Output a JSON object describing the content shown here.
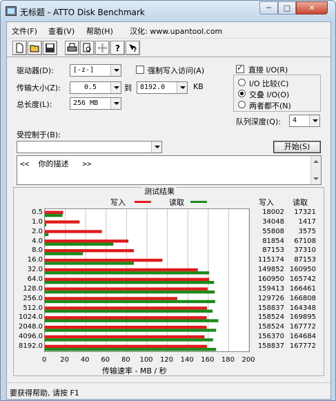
{
  "window": {
    "title": "无标题 - ATTO Disk Benchmark",
    "min_glyph": "─",
    "max_glyph": "□",
    "close_glyph": "✕"
  },
  "menu": [
    "文件(F)",
    "查看(V)",
    "帮助(H)",
    "汉化: www.upantool.com"
  ],
  "toolbar_icons": [
    "new-icon",
    "open-icon",
    "save-icon",
    "print-icon",
    "print-preview-icon",
    "move-icon",
    "help-icon",
    "context-help-icon"
  ],
  "settings": {
    "drive_label": "驱动器(D):",
    "drive_value": "[-z-]",
    "force_write_label": "强制写入访问(A)",
    "force_write_checked": false,
    "transfer_label": "传输大小(Z):",
    "transfer_from": "0.5",
    "transfer_to_label": "到",
    "transfer_to": "8192.0",
    "transfer_unit": "KB",
    "total_label": "总长度(L):",
    "total_value": "256 MB",
    "direct_io_label": "直接 I/O(R)",
    "direct_io_checked": true,
    "io_compare_label": "I/O 比较(C)",
    "io_interleave_label": "交叠 I/O(O)",
    "neither_label": "两者都不(N)",
    "queue_label": "队列深度(Q):",
    "queue_value": "4",
    "controlled_by_label": "受控制于(B):",
    "controlled_by_value": "",
    "start_label": "开始(S)",
    "description": "<<  你的描述   >>"
  },
  "results": {
    "title": "测试结果",
    "legend_write": "写入",
    "legend_read": "读取",
    "col_write": "写入",
    "col_read": "读取",
    "x_axis_label": "传输速率 - MB / 秒",
    "colors": {
      "write": "#e01b1b",
      "read": "#1b8a1b"
    }
  },
  "chart_data": {
    "type": "bar",
    "orientation": "horizontal",
    "title": "测试结果",
    "xlabel": "传输速率 - MB / 秒",
    "xlim": [
      0,
      200
    ],
    "xticks": [
      0,
      20,
      40,
      60,
      80,
      100,
      120,
      140,
      160,
      180,
      200
    ],
    "categories": [
      "0.5",
      "1.0",
      "2.0",
      "4.0",
      "8.0",
      "16.0",
      "32.0",
      "64.0",
      "128.0",
      "256.0",
      "512.0",
      "1024.0",
      "2048.0",
      "4096.0",
      "8192.0"
    ],
    "series": [
      {
        "name": "写入",
        "values": [
          18002,
          34048,
          55808,
          81854,
          87153,
          115174,
          149852,
          160950,
          159413,
          129726,
          158837,
          158524,
          158524,
          156370,
          158837
        ]
      },
      {
        "name": "读取",
        "values": [
          17321,
          1417,
          3575,
          67108,
          37310,
          87153,
          160950,
          165742,
          166461,
          166808,
          164348,
          169895,
          167772,
          164684,
          167772
        ]
      }
    ]
  },
  "status": "要获得帮助, 请按 F1"
}
